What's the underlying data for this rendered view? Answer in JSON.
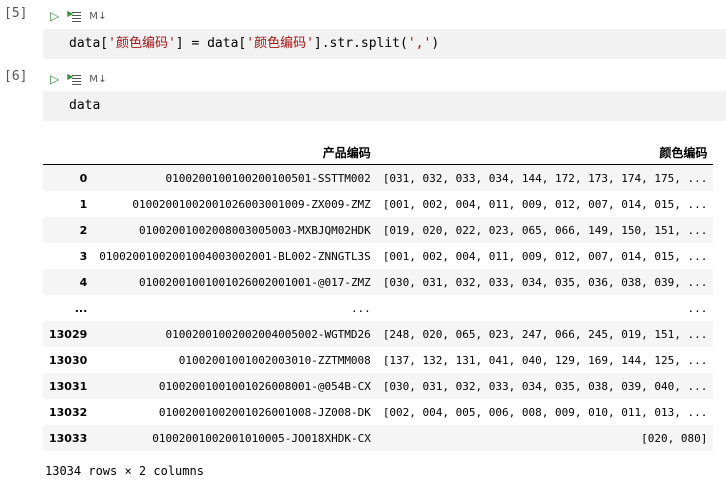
{
  "cells": [
    {
      "prompt": "[5]",
      "toolbar": {
        "markdown_label": "M↓"
      },
      "code": {
        "p1": "data[",
        "s1": "'颜色编码'",
        "p2": "] = data[",
        "s2": "'颜色编码'",
        "p3": "].str.split(",
        "s3": "','",
        "p4": ")"
      }
    },
    {
      "prompt": "[6]",
      "toolbar": {
        "markdown_label": "M↓"
      },
      "code": {
        "p1": "data"
      }
    }
  ],
  "table": {
    "columns": [
      "产品编码",
      "颜色编码"
    ],
    "rows": [
      {
        "index": "0",
        "code": "0100200100100200100501-SSTTM002",
        "colors": "[031, 032, 033, 034, 144, 172, 173, 174, 175, ..."
      },
      {
        "index": "1",
        "code": "0100200100200102600300100​9-ZX009-ZMZ",
        "colors": "[001, 002, 004, 011, 009, 012, 007, 014, 015, ..."
      },
      {
        "index": "2",
        "code": "0100200100200800300500​3-MXBJQM02HDK",
        "colors": "[019, 020, 022, 023, 065, 066, 149, 150, 151, ..."
      },
      {
        "index": "3",
        "code": "0100200100200100400300200​1-BL002-ZNNGTL3S",
        "colors": "[001, 002, 004, 011, 009, 012, 007, 014, 015, ..."
      },
      {
        "index": "4",
        "code": "0100200100100102600200100​1-@017-ZMZ",
        "colors": "[030, 031, 032, 033, 034, 035, 036, 038, 039, ..."
      },
      {
        "index": "...",
        "code": "...",
        "colors": "..."
      },
      {
        "index": "13029",
        "code": "0100200100200200400500​2-WGTMD26",
        "colors": "[248, 020, 065, 023, 247, 066, 245, 019, 151, ..."
      },
      {
        "index": "13030",
        "code": "0100200100100200301​0-ZZTMM008",
        "colors": "[137, 132, 131, 041, 040, 129, 169, 144, 125, ..."
      },
      {
        "index": "13031",
        "code": "0100200100100102600800​1-@054B-CX",
        "colors": "[030, 031, 032, 033, 034, 035, 038, 039, 040, ..."
      },
      {
        "index": "13032",
        "code": "0100200100200102600100​8-JZ008-DK",
        "colors": "[002, 004, 005, 006, 008, 009, 010, 011, 013, ..."
      },
      {
        "index": "13033",
        "code": "0100200100200101000​5-JO018XHDK-CX",
        "colors": "[020, 080]"
      }
    ],
    "footer": "13034 rows × 2 columns"
  }
}
